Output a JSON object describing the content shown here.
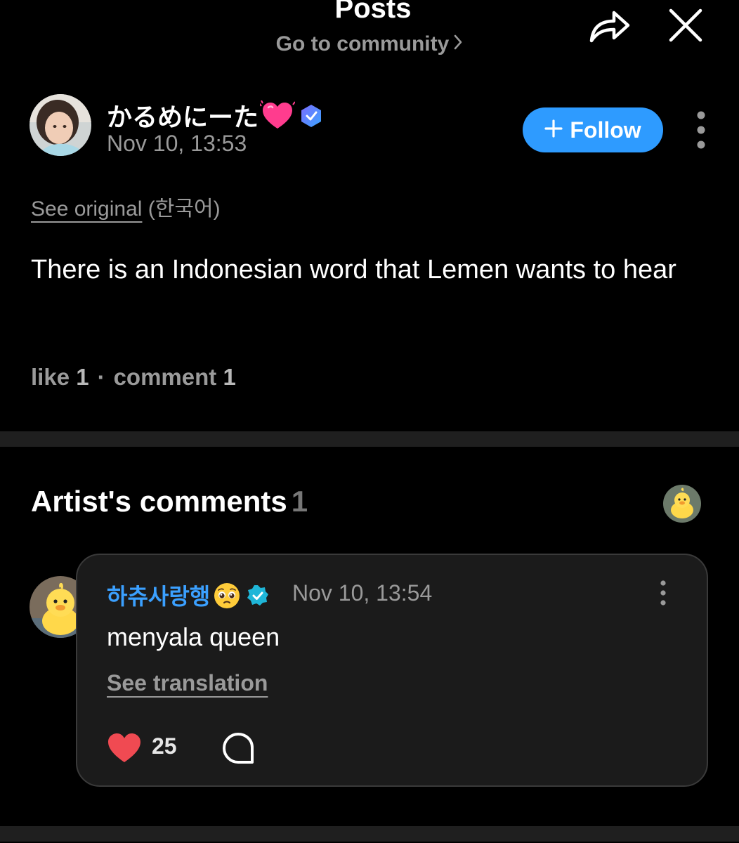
{
  "header": {
    "title": "Posts",
    "community_link": "Go to community",
    "share_icon": "share-icon",
    "close_icon": "close-icon"
  },
  "post": {
    "author": {
      "name": "かるめにーた",
      "emoji": "heart-emoji",
      "badge": "verified-fan-badge"
    },
    "time": "Nov 10, 13:53",
    "follow_label": "Follow",
    "see_original_label": "See original",
    "original_language": "(한국어)",
    "body": "There is an Indonesian word that Lemen wants to hear",
    "like_label": "like",
    "like_count": "1",
    "separator": "·",
    "comment_label": "comment",
    "comment_count": "1"
  },
  "artist_comments": {
    "title": "Artist's comments",
    "count": "1",
    "comments": [
      {
        "author": "하츄사랑행",
        "time": "Nov 10, 13:54",
        "text": "menyala queen",
        "see_translation_label": "See translation",
        "likes": "25"
      }
    ]
  },
  "colors": {
    "background": "#000000",
    "accent": "#2e9bff",
    "artist_name": "#3ba0ff",
    "like_heart": "#f04a52",
    "muted_text": "#9a9a9a",
    "card": "#1b1b1b"
  }
}
